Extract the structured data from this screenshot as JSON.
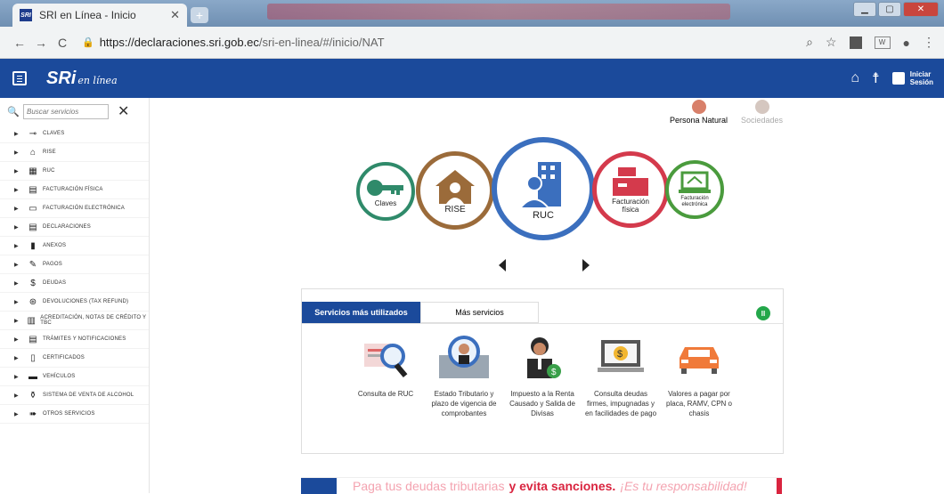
{
  "browser": {
    "tab_title": "SRI en Línea - Inicio",
    "favicon_text": "SRI",
    "url_host": "https://declaraciones.sri.gob.ec",
    "url_path": "/sri-en-linea/#/inicio/NAT"
  },
  "header": {
    "logo": "SRi",
    "logo_sub": "en línea",
    "login_line1": "Iniciar",
    "login_line2": "Sesión",
    "brand_color": "#1b4a9b"
  },
  "sidebar": {
    "search_placeholder": "Buscar servicios",
    "items": [
      {
        "label": "CLAVES",
        "icon": "key-icon"
      },
      {
        "label": "RISE",
        "icon": "building-icon"
      },
      {
        "label": "RUC",
        "icon": "office-icon"
      },
      {
        "label": "FACTURACIÓN FÍSICA",
        "icon": "cash-register-icon"
      },
      {
        "label": "FACTURACIÓN ELECTRÓNICA",
        "icon": "laptop-icon"
      },
      {
        "label": "DECLARACIONES",
        "icon": "document-icon"
      },
      {
        "label": "ANEXOS",
        "icon": "file-icon"
      },
      {
        "label": "PAGOS",
        "icon": "pen-icon"
      },
      {
        "label": "DEUDAS",
        "icon": "dollar-icon"
      },
      {
        "label": "DEVOLUCIONES (TAX REFUND)",
        "icon": "refund-icon"
      },
      {
        "label": "ACREDITACIÓN, NOTAS DE CRÉDITO Y TBC",
        "icon": "notes-icon"
      },
      {
        "label": "TRÁMITES Y NOTIFICACIONES",
        "icon": "notification-icon"
      },
      {
        "label": "CERTIFICADOS",
        "icon": "certificate-icon"
      },
      {
        "label": "VEHÍCULOS",
        "icon": "car-icon"
      },
      {
        "label": "SISTEMA DE VENTA DE ALCOHOL",
        "icon": "alcohol-icon"
      },
      {
        "label": "OTROS SERVICIOS",
        "icon": "arrow-icon"
      }
    ]
  },
  "user_type": {
    "natural": "Persona Natural",
    "company": "Sociedades"
  },
  "carousel": {
    "claves": "Claves",
    "rise": "RISE",
    "ruc": "RUC",
    "fact_fisica": "Facturación física",
    "fact_electronica": "Facturación electrónica"
  },
  "services": {
    "tab_used": "Servicios más utilizados",
    "tab_more": "Más servicios",
    "items": [
      {
        "label": "Consulta de RUC"
      },
      {
        "label": "Estado Tributario y plazo de vigencia de comprobantes"
      },
      {
        "label": "Impuesto a la Renta Causado y Salida de Divisas"
      },
      {
        "label": "Consulta deudas firmes, impugnadas y en facilidades de pago"
      },
      {
        "label": "Valores a pagar por placa, RAMV, CPN o chasis"
      }
    ]
  },
  "banner": {
    "part1": "Paga tus deudas tributarias",
    "part2": "y evita sanciones.",
    "part3": "¡Es tu responsabilidad!"
  }
}
